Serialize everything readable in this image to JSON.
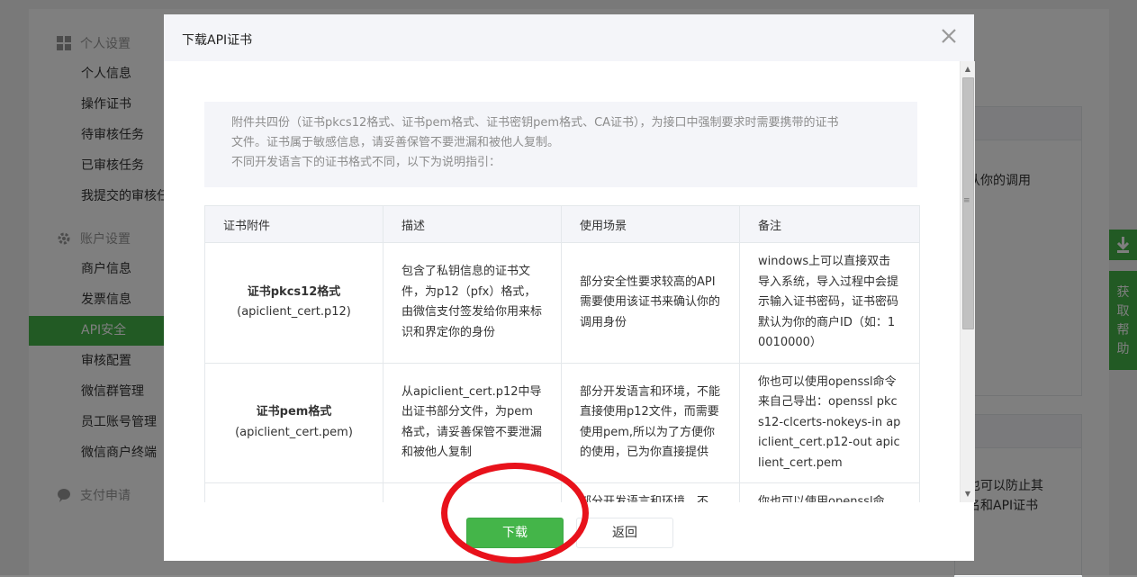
{
  "background": {
    "sidebar": {
      "sections": [
        {
          "label": "个人设置",
          "icon": "grid-icon"
        },
        {
          "label": "账户设置",
          "icon": "gear-icon"
        },
        {
          "label": "支付申请",
          "icon": "chat-icon"
        }
      ],
      "personal_items": [
        "个人信息",
        "操作证书",
        "待审核任务",
        "已审核任务",
        "我提交的审核任"
      ],
      "account_items": [
        "商户信息",
        "发票信息",
        "API安全",
        "审核配置",
        "微信群管理",
        "员工账号管理",
        "微信商户终端"
      ],
      "active_item": "API安全"
    },
    "main_snippets": [
      "认你的调用",
      "也可以防止其",
      "名和API证书"
    ],
    "right_tabs": {
      "download_icon": "download-icon",
      "help_label": "获取帮助"
    },
    "colors": {
      "accent": "#44b549"
    }
  },
  "dialog": {
    "title": "下载API证书",
    "notice": [
      "附件共四份（证书pkcs12格式、证书pem格式、证书密钥pem格式、CA证书），为接口中强制要求时需要携带的证书",
      "文件。证书属于敏感信息，请妥善保管不要泄漏和被他人复制。",
      "不同开发语言下的证书格式不同，以下为说明指引："
    ],
    "table": {
      "headers": [
        "证书附件",
        "描述",
        "使用场景",
        "备注"
      ],
      "rows": [
        {
          "name": "证书pkcs12格式",
          "file": "(apiclient_cert.p12)",
          "desc": "包含了私钥信息的证书文件，为p12（pfx）格式，由微信支付签发给你用来标识和界定你的身份",
          "scene": "部分安全性要求较高的API需要使用该证书来确认你的调用身份",
          "note": "windows上可以直接双击导入系统，导入过程中会提示输入证书密码，证书密码默认为你的商户ID（如：10010000）"
        },
        {
          "name": "证书pem格式",
          "file": "(apiclient_cert.pem)",
          "desc": "从apiclient_cert.p12中导出证书部分文件，为pem格式，请妥善保管不要泄漏和被他人复制",
          "scene": "部分开发语言和环境，不能直接使用p12文件，而需要使用pem,所以为了方便你的使用，已为你直接提供",
          "note": "你也可以使用openssl命令来自己导出：openssl pkcs12-clcerts-nokeys-in apiclient_cert.p12-out apiclient_cert.pem"
        },
        {
          "name": "",
          "file": "",
          "desc": "",
          "scene": "部分开发语言和环境，不",
          "note": "你也可以使用openssl命"
        }
      ]
    },
    "buttons": {
      "download": "下载",
      "back": "返回"
    }
  }
}
